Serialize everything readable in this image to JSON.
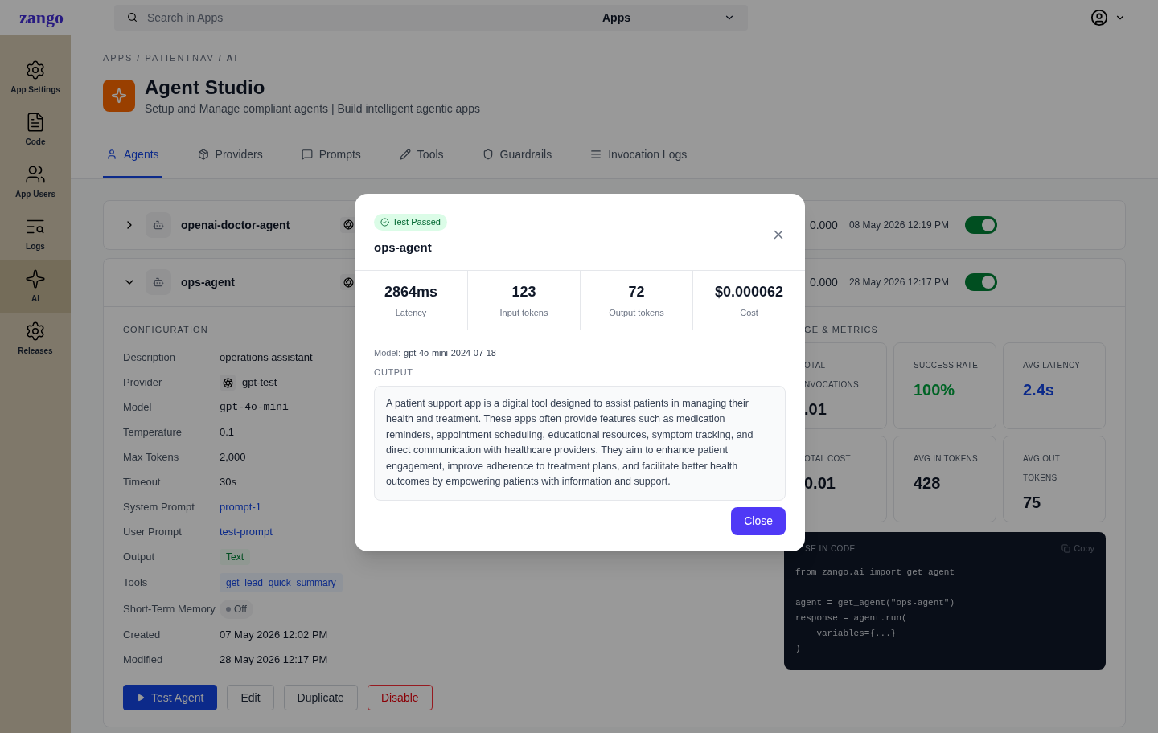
{
  "topbar": {
    "logo": "zango",
    "search": {
      "placeholder": "Search in Apps"
    },
    "app_select": "Apps"
  },
  "sidebar": {
    "items": [
      {
        "label": "App Settings",
        "selected": false
      },
      {
        "label": "Code",
        "selected": false
      },
      {
        "label": "App Users",
        "selected": false
      },
      {
        "label": "Logs",
        "selected": false
      },
      {
        "label": "AI",
        "selected": true
      },
      {
        "label": "Releases",
        "selected": false
      }
    ]
  },
  "breadcrumb": "APPS / PATIENTNAV **/ AI**",
  "header": {
    "title": "Agent Studio",
    "subtitle": "Setup and Manage compliant agents | Build intelligent agentic apps"
  },
  "tabs": [
    {
      "label": "Agents",
      "selected": true
    },
    {
      "label": "Providers",
      "selected": false
    },
    {
      "label": "Prompts",
      "selected": false
    },
    {
      "label": "Tools",
      "selected": false
    },
    {
      "label": "Guardrails",
      "selected": false
    },
    {
      "label": "Invocation Logs",
      "selected": false
    }
  ],
  "agents": [
    {
      "name": "openai-doctor-agent",
      "expanded": false,
      "cost": "0.000",
      "date": "08 May 2026 12:19 PM",
      "enabled": true
    },
    {
      "name": "ops-agent",
      "expanded": true,
      "cost": "0.000",
      "date": "28 May 2026 12:17 PM",
      "enabled": true
    }
  ],
  "configuration": {
    "heading": "CONFIGURATION",
    "fields": [
      {
        "label": "Description",
        "value": "operations assistant",
        "kind": "text"
      },
      {
        "label": "Provider",
        "value": "gpt-test",
        "kind": "provider"
      },
      {
        "label": "Model",
        "value": "gpt-4o-mini",
        "kind": "mono"
      },
      {
        "label": "Temperature",
        "value": "0.1",
        "kind": "text"
      },
      {
        "label": "Max Tokens",
        "value": "2,000",
        "kind": "text"
      },
      {
        "label": "Timeout",
        "value": "30s",
        "kind": "text"
      },
      {
        "label": "System Prompt",
        "value": "prompt-1",
        "kind": "link"
      },
      {
        "label": "User Prompt",
        "value": "test-prompt",
        "kind": "link"
      },
      {
        "label": "Output",
        "value": "Text",
        "kind": "badge"
      },
      {
        "label": "Tools",
        "value": "get_lead_quick_summary",
        "kind": "tag"
      },
      {
        "label": "Short-Term Memory",
        "value": "Off",
        "kind": "status"
      },
      {
        "label": "Created",
        "value": "07 May 2026 12:02 PM",
        "kind": "text"
      },
      {
        "label": "Modified",
        "value": "28 May 2026 12:17 PM",
        "kind": "text"
      }
    ]
  },
  "actions": [
    {
      "label": "Test Agent",
      "kind": "primary"
    },
    {
      "label": "Edit",
      "kind": "outline"
    },
    {
      "label": "Duplicate",
      "kind": "outline"
    },
    {
      "label": "Disable",
      "kind": "danger"
    }
  ],
  "metrics": {
    "heading": "GE & METRICS",
    "cards": [
      {
        "label": "OTAL NVOCATIONS",
        "value": ".01",
        "kind": "plain"
      },
      {
        "label": "SUCCESS RATE",
        "value": "100%",
        "kind": "success"
      },
      {
        "label": "AVG LATENCY",
        "value": "2.4s",
        "kind": "info"
      },
      {
        "label": "OTAL COST",
        "value": "0.01",
        "kind": "plain"
      },
      {
        "label": "AVG IN TOKENS",
        "value": "428",
        "kind": "plain"
      },
      {
        "label": "AVG OUT TOKENS",
        "value": "75",
        "kind": "plain"
      }
    ]
  },
  "code": {
    "heading": "SE IN CODE",
    "copy": "Copy",
    "blocks": [
      [
        "from zango.ai import get_agent"
      ],
      [
        "agent = get_agent(\"ops-agent\")",
        "response = agent.run(",
        "    variables={...}",
        ")"
      ]
    ]
  },
  "modal": {
    "status": "Test Passed",
    "title": "ops-agent",
    "stats": [
      {
        "value": "2864ms",
        "label": "Latency"
      },
      {
        "value": "123",
        "label": "Input tokens"
      },
      {
        "value": "72",
        "label": "Output tokens"
      },
      {
        "value": "$0.000062",
        "label": "Cost"
      }
    ],
    "model_label": "Model:",
    "model": "gpt-4o-mini-2024-07-18",
    "output_heading": "OUTPUT",
    "output": "A patient support app is a digital tool designed to assist patients in managing their health and treatment. These apps often provide features such as medication reminders, appointment scheduling, educational resources, symptom tracking, and direct communication with healthcare providers. They aim to enhance patient engagement, improve adherence to treatment plans, and facilitate better health outcomes by empowering patients with information and support.",
    "close": "Close"
  }
}
